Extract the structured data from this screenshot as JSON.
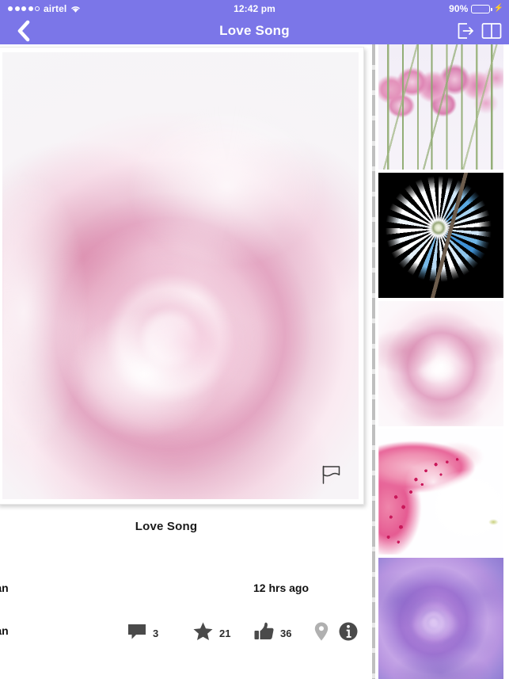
{
  "status_bar": {
    "carrier": "airtel",
    "signal_filled_dots": 4,
    "signal_empty_dots": 1,
    "wifi_icon": "wifi-icon",
    "time": "12:42 pm",
    "battery_percent": "90%",
    "battery_level": 90,
    "charging": true,
    "bolt_icon": "charging-bolt-icon",
    "background_color": "#7b76e8",
    "text_color": "#ffffff"
  },
  "nav_bar": {
    "back_icon": "chevron-left-icon",
    "title": "Love Song",
    "actions": [
      {
        "name": "share-export-icon",
        "label": "Export"
      },
      {
        "name": "book-icon",
        "label": "Book"
      }
    ],
    "background_color": "#7b76e8"
  },
  "detail": {
    "photo": {
      "name": "Love Song",
      "alt": "Close-up of a soft pink rose",
      "flag_icon": "flag-icon"
    },
    "title": "Love Song",
    "owner_top": "rwan",
    "owner_bottom": "rwan",
    "timestamp": "12 hrs ago",
    "actions": [
      {
        "name": "comment",
        "icon": "comment-bubble-icon",
        "count": "3"
      },
      {
        "name": "favorite",
        "icon": "star-icon",
        "count": "21"
      },
      {
        "name": "like",
        "icon": "thumbs-up-icon",
        "count": "36"
      },
      {
        "name": "location",
        "icon": "location-pin-icon",
        "count": ""
      },
      {
        "name": "info",
        "icon": "info-circle-icon",
        "count": ""
      }
    ]
  },
  "thumbnails": [
    {
      "id": "thumb-1",
      "alt": "Pink carnations bouquet"
    },
    {
      "id": "thumb-2",
      "alt": "Blue and white spiky flower on black"
    },
    {
      "id": "thumb-3",
      "alt": "Pale pink rose close-up"
    },
    {
      "id": "thumb-4",
      "alt": "Pink spotted lily petal"
    },
    {
      "id": "thumb-5",
      "alt": "Purple rose close-up"
    }
  ],
  "colors": {
    "accent": "#7b76e8",
    "battery_green": "#4cd964",
    "icon_dark": "#4a4a4a",
    "icon_muted": "#b0b0b0",
    "page_background": "#ffffff"
  }
}
